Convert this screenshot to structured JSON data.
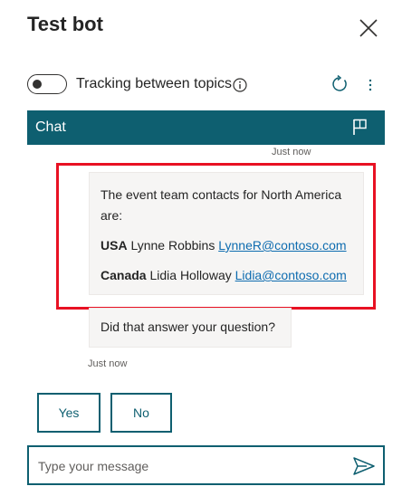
{
  "header": {
    "title": "Test bot"
  },
  "tracking": {
    "label": "Tracking between topics",
    "enabled": false
  },
  "chat": {
    "title": "Chat",
    "messages": [
      {
        "timestamp": "Just now",
        "intro": "The event team contacts for North America are:",
        "contacts": [
          {
            "region": "USA",
            "name": "Lynne Robbins",
            "email": "LynneR@contoso.com"
          },
          {
            "region": "Canada",
            "name": "Lidia Holloway",
            "email": "Lidia@contoso.com"
          }
        ]
      },
      {
        "text": "Did that answer your question?",
        "timestamp": "Just now"
      }
    ],
    "suggested_actions": [
      "Yes",
      "No"
    ],
    "input": {
      "placeholder": "Type your message",
      "value": ""
    }
  },
  "icons": [
    "close-icon",
    "info-icon",
    "refresh-icon",
    "more-icon",
    "flag-icon",
    "send-icon"
  ],
  "colors": {
    "accent": "#0e5f70",
    "highlight": "#e81123",
    "link": "#0e6cb0",
    "bubble": "#f6f5f4"
  }
}
